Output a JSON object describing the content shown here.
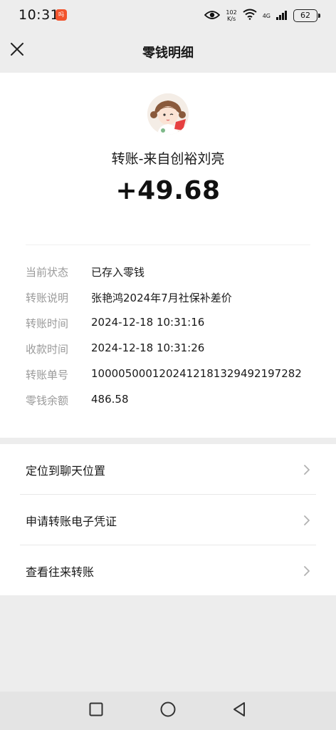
{
  "status_bar": {
    "time": "10:31",
    "notification_badge": "吗",
    "speed_value": "102",
    "speed_unit": "K/s",
    "network": "4G",
    "battery": "62"
  },
  "header": {
    "title": "零钱明细",
    "close_icon": "close-icon"
  },
  "transaction": {
    "title": "转账-来自创裕刘亮",
    "amount": "+49.68",
    "details": [
      {
        "label": "当前状态",
        "value": "已存入零钱"
      },
      {
        "label": "转账说明",
        "value": "张艳鸿2024年7月社保补差价"
      },
      {
        "label": "转账时间",
        "value": "2024-12-18 10:31:16"
      },
      {
        "label": "收款时间",
        "value": "2024-12-18 10:31:26"
      },
      {
        "label": "转账单号",
        "value": "1000050001202412181329492197282"
      },
      {
        "label": "零钱余额",
        "value": "486.58"
      }
    ]
  },
  "actions": [
    {
      "label": "定位到聊天位置",
      "icon": "chevron-right-icon"
    },
    {
      "label": "申请转账电子凭证",
      "icon": "chevron-right-icon"
    },
    {
      "label": "查看往来转账",
      "icon": "chevron-right-icon"
    }
  ],
  "system_nav": {
    "recents_icon": "square-icon",
    "home_icon": "circle-icon",
    "back_icon": "triangle-back-icon"
  },
  "colors": {
    "page_background": "#ededed",
    "card_background": "#ffffff",
    "label_gray": "#9a9a9a",
    "text_dark": "#191919",
    "notification_red": "#f2542d"
  }
}
